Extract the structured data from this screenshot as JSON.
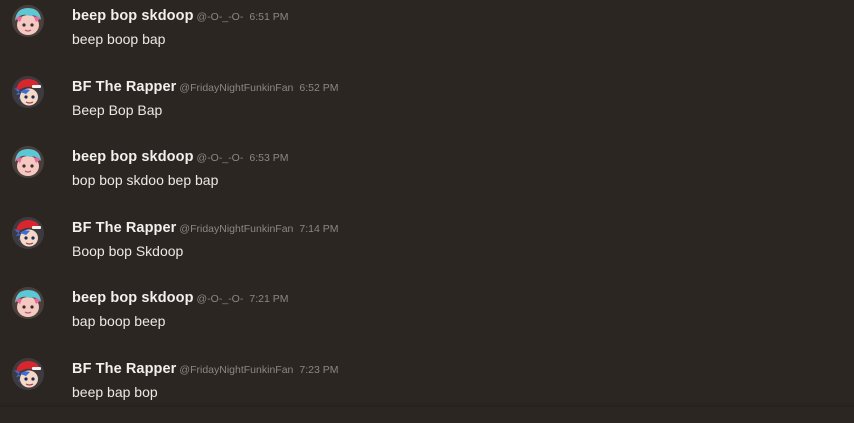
{
  "colors": {
    "background": "#2b2622",
    "username": "#f2efec",
    "meta": "#8d8782",
    "body": "#ece8e4"
  },
  "messages": [
    {
      "avatar": "pink-hair-avatar-icon",
      "username": "beep bop skdoop",
      "handle": "@-O-_-O-",
      "time": "6:51 PM",
      "text": "beep boop bap"
    },
    {
      "avatar": "blue-hair-red-cap-avatar-icon",
      "username": "BF The Rapper",
      "handle": "@FridayNightFunkinFan",
      "time": "6:52 PM",
      "text": "Beep Bop Bap"
    },
    {
      "avatar": "pink-hair-avatar-icon",
      "username": "beep bop skdoop",
      "handle": "@-O-_-O-",
      "time": "6:53 PM",
      "text": "bop bop skdoo bep bap"
    },
    {
      "avatar": "blue-hair-red-cap-avatar-icon",
      "username": "BF The Rapper",
      "handle": "@FridayNightFunkinFan",
      "time": "7:14 PM",
      "text": "Boop bop Skdoop"
    },
    {
      "avatar": "pink-hair-avatar-icon",
      "username": "beep bop skdoop",
      "handle": "@-O-_-O-",
      "time": "7:21 PM",
      "text": "bap boop beep"
    },
    {
      "avatar": "blue-hair-red-cap-avatar-icon",
      "username": "BF The Rapper",
      "handle": "@FridayNightFunkinFan",
      "time": "7:23 PM",
      "text": "beep bap bop"
    }
  ]
}
